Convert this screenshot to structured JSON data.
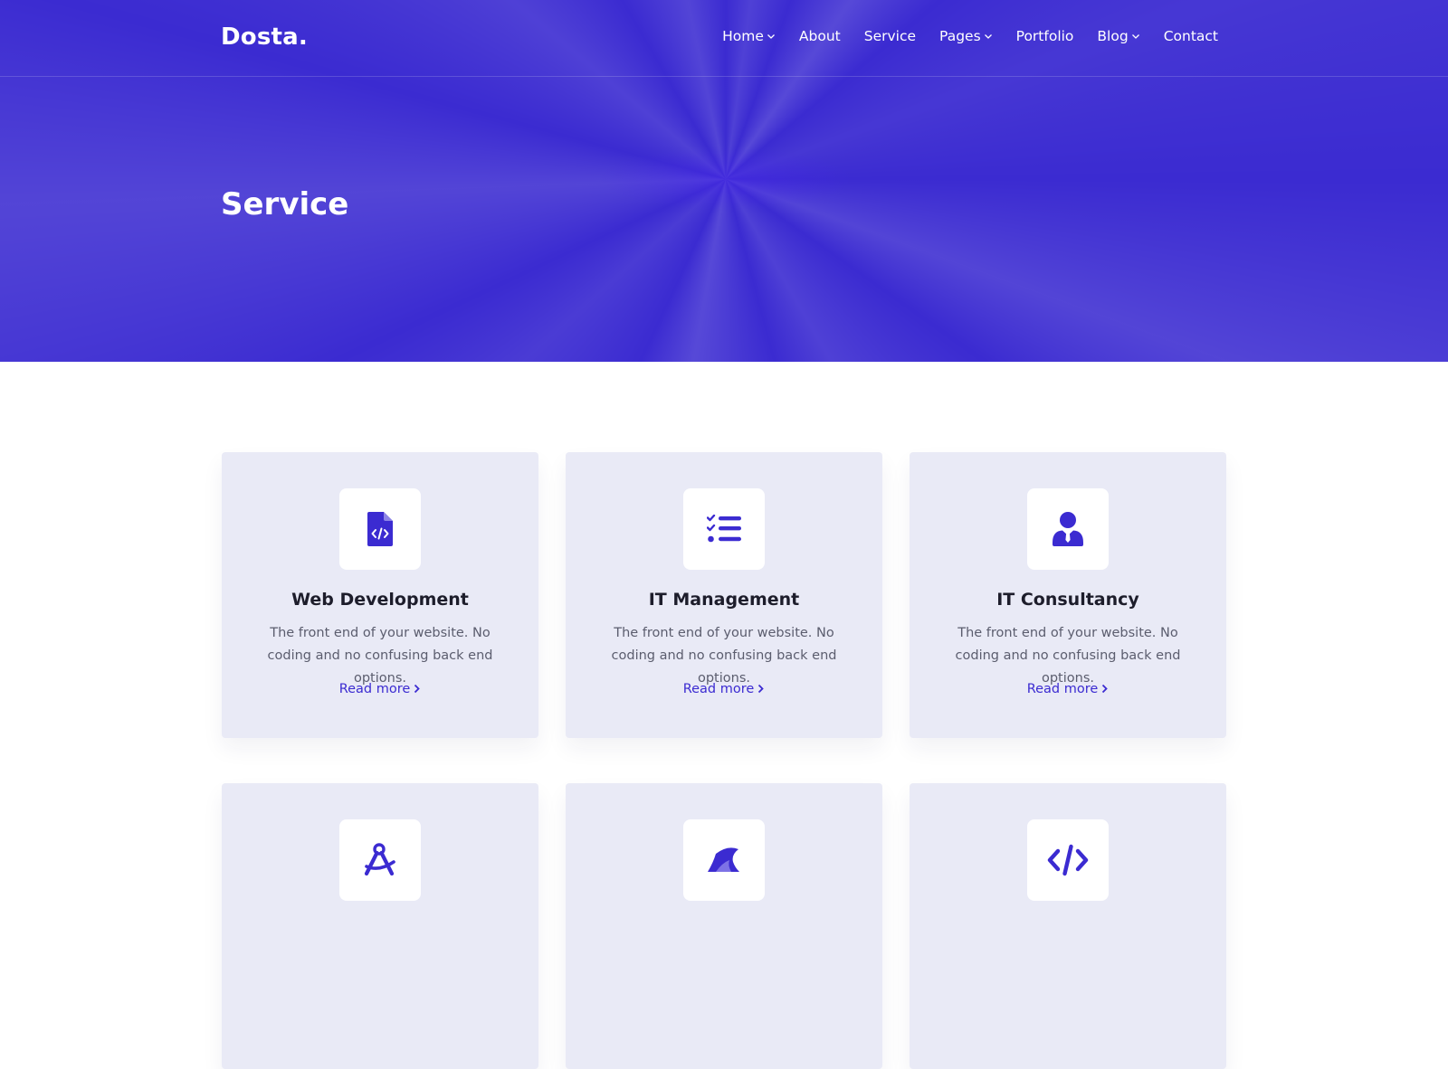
{
  "colors": {
    "brand": "#3b2bd1",
    "card_bg": "#e9eaf6",
    "heading": "#1d1d2b",
    "body_text": "#5b5d6e"
  },
  "header": {
    "logo": "Dosta.",
    "nav": [
      {
        "label": "Home",
        "has_dropdown": true
      },
      {
        "label": "About",
        "has_dropdown": false
      },
      {
        "label": "Service",
        "has_dropdown": false
      },
      {
        "label": "Pages",
        "has_dropdown": true
      },
      {
        "label": "Portfolio",
        "has_dropdown": false
      },
      {
        "label": "Blog",
        "has_dropdown": true
      },
      {
        "label": "Contact",
        "has_dropdown": false
      }
    ]
  },
  "hero": {
    "title": "Service"
  },
  "services": [
    {
      "icon": "file-code-icon",
      "title": "Web Development",
      "text": "The front end of your website. No coding and no confusing back end options.",
      "link": "Read more"
    },
    {
      "icon": "tasks-list-icon",
      "title": "IT Management",
      "text": "The front end of your website. No coding and no confusing back end options.",
      "link": "Read more"
    },
    {
      "icon": "user-tie-icon",
      "title": "IT Consultancy",
      "text": "The front end of your website. No coding and no confusing back end options.",
      "link": "Read more"
    },
    {
      "icon": "drafting-compass-icon",
      "title": "",
      "text": "",
      "link": ""
    },
    {
      "icon": "shark-fin-icon",
      "title": "",
      "text": "",
      "link": ""
    },
    {
      "icon": "code-icon",
      "title": "",
      "text": "",
      "link": ""
    }
  ]
}
